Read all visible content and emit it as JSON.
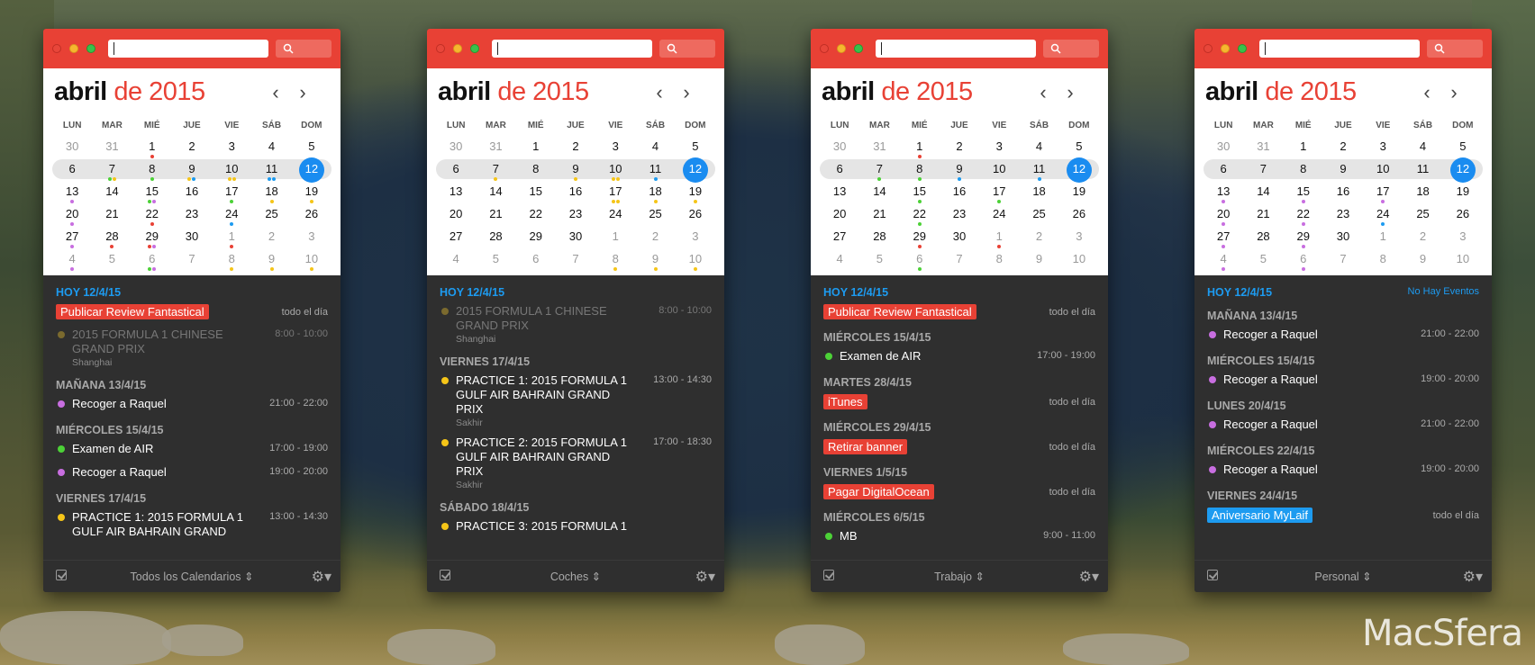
{
  "watermark": "MacSfera",
  "colors": {
    "red": "#e84135",
    "blue": "#1d9bf0",
    "green": "#4cd137",
    "purple": "#c86ee0",
    "yellow": "#f5c518",
    "orange": "#f0a030",
    "olive": "#7b6a2e"
  },
  "calendar": {
    "month": "abril",
    "de": "de",
    "year": "2015",
    "dows": [
      "LUN",
      "MAR",
      "MIÉ",
      "JUE",
      "VIE",
      "SÁB",
      "DOM"
    ],
    "weeks": [
      [
        "30",
        "31",
        "1",
        "2",
        "3",
        "4",
        "5"
      ],
      [
        "6",
        "7",
        "8",
        "9",
        "10",
        "11",
        "12"
      ],
      [
        "13",
        "14",
        "15",
        "16",
        "17",
        "18",
        "19"
      ],
      [
        "20",
        "21",
        "22",
        "23",
        "24",
        "25",
        "26"
      ],
      [
        "27",
        "28",
        "29",
        "30",
        "1",
        "2",
        "3"
      ],
      [
        "4",
        "5",
        "6",
        "7",
        "8",
        "9",
        "10"
      ]
    ]
  },
  "windows": [
    {
      "footer_label": "Todos los Calendarios ⇕"
    },
    {
      "footer_label": "Coches ⇕"
    },
    {
      "footer_label": "Trabajo ⇕"
    },
    {
      "footer_label": "Personal ⇕"
    }
  ],
  "w1": {
    "hoy": "HOY 12/4/15",
    "e1_title": "Publicar Review Fantastical",
    "e1_time": "todo el día",
    "e2_title": "2015 FORMULA 1 CHINESE GRAND PRIX",
    "e2_time": "8:00 - 10:00",
    "e2_loc": "Shanghai",
    "s2": "MAÑANA 13/4/15",
    "e3_title": "Recoger a Raquel",
    "e3_time": "21:00 - 22:00",
    "s3": "MIÉRCOLES 15/4/15",
    "e4_title": "Examen de AIR",
    "e4_time": "17:00 - 19:00",
    "e5_title": "Recoger a Raquel",
    "e5_time": "19:00 - 20:00",
    "s4": "VIERNES 17/4/15",
    "e6_title": "PRACTICE 1: 2015 FORMULA 1 GULF AIR BAHRAIN GRAND",
    "e6_time": "13:00 - 14:30"
  },
  "w2": {
    "hoy": "HOY 12/4/15",
    "e1_title": "2015 FORMULA 1 CHINESE GRAND PRIX",
    "e1_time": "8:00 - 10:00",
    "e1_loc": "Shanghai",
    "s2": "VIERNES 17/4/15",
    "e2_title": "PRACTICE 1: 2015 FORMULA 1 GULF AIR BAHRAIN GRAND PRIX",
    "e2_time": "13:00 - 14:30",
    "e2_loc": "Sakhir",
    "e3_title": "PRACTICE 2: 2015 FORMULA 1 GULF AIR BAHRAIN GRAND PRIX",
    "e3_time": "17:00 - 18:30",
    "e3_loc": "Sakhir",
    "s3": "SÁBADO 18/4/15",
    "e4_title": "PRACTICE 3: 2015 FORMULA 1"
  },
  "w3": {
    "hoy": "HOY 12/4/15",
    "e1_title": "Publicar Review Fantastical",
    "e1_time": "todo el día",
    "s2": "MIÉRCOLES 15/4/15",
    "e2_title": "Examen de AIR",
    "e2_time": "17:00 - 19:00",
    "s3": "MARTES 28/4/15",
    "e3_title": "iTunes",
    "e3_time": "todo el día",
    "s4": "MIÉRCOLES 29/4/15",
    "e4_title": "Retirar banner",
    "e4_time": "todo el día",
    "s5": "VIERNES 1/5/15",
    "e5_title": "Pagar DigitalOcean",
    "e5_time": "todo el día",
    "s6": "MIÉRCOLES 6/5/15",
    "e6_title": "MB",
    "e6_time": "9:00 - 11:00"
  },
  "w4": {
    "hoy": "HOY 12/4/15",
    "nohay": "No Hay Eventos",
    "s2": "MAÑANA 13/4/15",
    "e1_title": "Recoger a Raquel",
    "e1_time": "21:00 - 22:00",
    "s3": "MIÉRCOLES 15/4/15",
    "e2_title": "Recoger a Raquel",
    "e2_time": "19:00 - 20:00",
    "s4": "LUNES 20/4/15",
    "e3_title": "Recoger a Raquel",
    "e3_time": "21:00 - 22:00",
    "s5": "MIÉRCOLES 22/4/15",
    "e4_title": "Recoger a Raquel",
    "e4_time": "19:00 - 20:00",
    "s6": "VIERNES 24/4/15",
    "e5_title": "Aniversario MyLaif",
    "e5_time": "todo el día"
  },
  "dots": [
    {
      "2": "r",
      "8": "gy",
      "9": "g",
      "10": "yb",
      "11": "yy",
      "12": "bb",
      "14": "p",
      "16": "gp",
      "18": "g",
      "19": "y",
      "20": "y",
      "21": "p",
      "23": "r",
      "25": "b",
      "28": "p",
      "29": "r",
      "30": "rp",
      "32": "r",
      "35": "p",
      "37": "gp",
      "39": "y",
      "40": "y",
      "41": "y"
    },
    {
      "8": "y",
      "10": "y",
      "11": "yy",
      "12": "b",
      "18": "yy",
      "19": "y",
      "20": "y",
      "39": "y",
      "40": "y",
      "41": "y"
    },
    {
      "2": "r",
      "8": "g",
      "9": "g",
      "10": "b",
      "12": "b",
      "16": "g",
      "18": "g",
      "23": "g",
      "32": "r",
      "30": "r",
      "37": "g"
    },
    {
      "14": "p",
      "16": "p",
      "18": "p",
      "21": "p",
      "23": "p",
      "25": "b",
      "28": "p",
      "30": "p",
      "35": "p",
      "37": "p"
    }
  ]
}
